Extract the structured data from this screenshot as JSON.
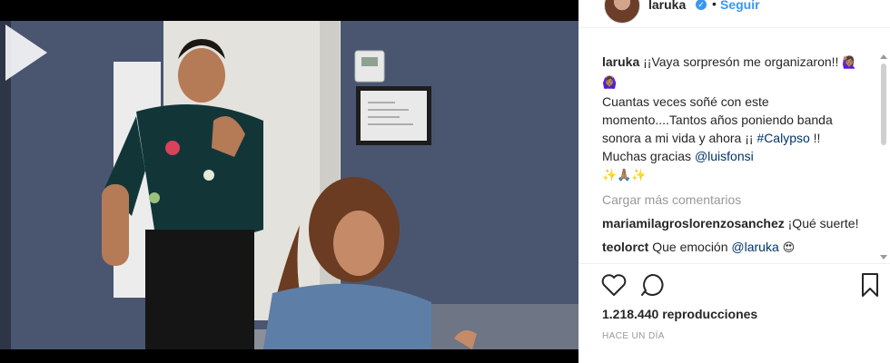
{
  "post": {
    "username": "laruka",
    "follow_label": "Seguir",
    "separator": "•"
  },
  "caption": {
    "username": "laruka",
    "line1": "¡¡Vaya sorpresón me organizaron!!",
    "line1_emoji": "🙋🏽‍♀️🙆🏽‍♀️",
    "body": "Cuantas veces soñé con este momento....Tantos años poniendo banda sonora a mi vida y ahora ¡¡ ",
    "hashtag": "#Calypso",
    "after_hashtag": " !!",
    "thanks": "Muchas gracias ",
    "mention": "@luisfonsi",
    "end_emoji": "✨🙏🏽✨"
  },
  "load_more_label": "Cargar más comentarios",
  "comments": [
    {
      "username": "mariamilagroslorenzosanchez",
      "text": "¡Qué suerte!"
    },
    {
      "username": "teolorct",
      "text": "Que emoción ",
      "mention": "@laruka",
      "emoji": "😍"
    }
  ],
  "views": {
    "count": "1.218.440",
    "label": "reproducciones"
  },
  "timestamp": "HACE UN DÍA",
  "icons": [
    "heart-icon",
    "comment-icon",
    "bookmark-icon",
    "play-icon",
    "verified-icon"
  ],
  "colors": {
    "link_blue": "#3897f0",
    "mention_navy": "#003569",
    "muted_gray": "#999999"
  }
}
